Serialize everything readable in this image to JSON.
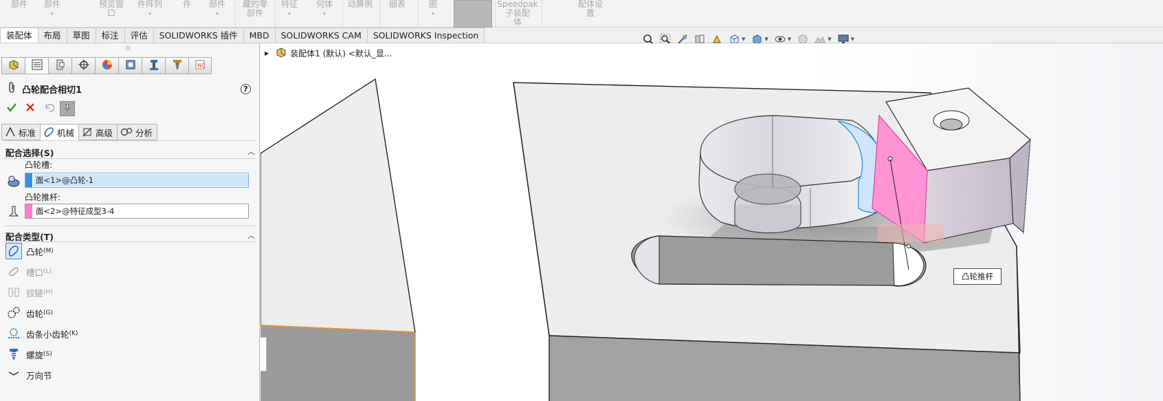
{
  "ribbon": {
    "items": [
      {
        "label": "部件",
        "sub": ""
      },
      {
        "label": "部件",
        "sub": "▾"
      },
      {
        "label": "预览窗",
        "sub": "口"
      },
      {
        "label": "件阵列",
        "sub": "▾"
      },
      {
        "label": "件",
        "sub": ""
      },
      {
        "label": "部件",
        "sub": "▾"
      },
      {
        "label": "藏的零",
        "sub": "部件"
      },
      {
        "label": "特征",
        "sub": "▾"
      },
      {
        "label": "何体",
        "sub": "▾"
      },
      {
        "label": "动算例",
        "sub": ""
      },
      {
        "label": "细表",
        "sub": ""
      },
      {
        "label": "图",
        "sub": "▾"
      },
      {
        "label": "Speedpak",
        "sub": "子装配",
        "sub2": "体"
      },
      {
        "label": "配体设",
        "sub": "置"
      }
    ]
  },
  "tabs": [
    "装配体",
    "布局",
    "草图",
    "标注",
    "评估",
    "SOLIDWORKS 插件",
    "MBD",
    "SOLIDWORKS CAM",
    "SOLIDWORKS Inspection"
  ],
  "panel": {
    "title": "凸轮配合相切1",
    "help": "?",
    "mate_tabs": [
      "标准",
      "机械",
      "高级",
      "分析"
    ],
    "selections_header": "配合选择(S)",
    "cam_slot_label": "凸轮槽:",
    "cam_slot_value": "面<1>@凸轮-1",
    "cam_follower_label": "凸轮推杆:",
    "cam_follower_value": "面<2>@特征成型3-4",
    "types_header": "配合类型(T)",
    "types": [
      {
        "label": "凸轮",
        "key": "(M)"
      },
      {
        "label": "槽口",
        "key": "(L)"
      },
      {
        "label": "铰链",
        "key": "(H)"
      },
      {
        "label": "齿轮",
        "key": "(G)"
      },
      {
        "label": "齿条小齿轮",
        "key": "(K)"
      },
      {
        "label": "螺旋",
        "key": "(S)"
      },
      {
        "label": "万向节",
        "key": ""
      }
    ]
  },
  "viewport": {
    "tree_label": "装配体1 (默认) <默认_显...",
    "callout": "凸轮推杆"
  },
  "colors": {
    "accent": "#4a86c5",
    "cam_slot": "#3a8fdc",
    "cam_follower": "#ff7ec8",
    "ok": "#2e9e2e",
    "cancel": "#d92020"
  }
}
